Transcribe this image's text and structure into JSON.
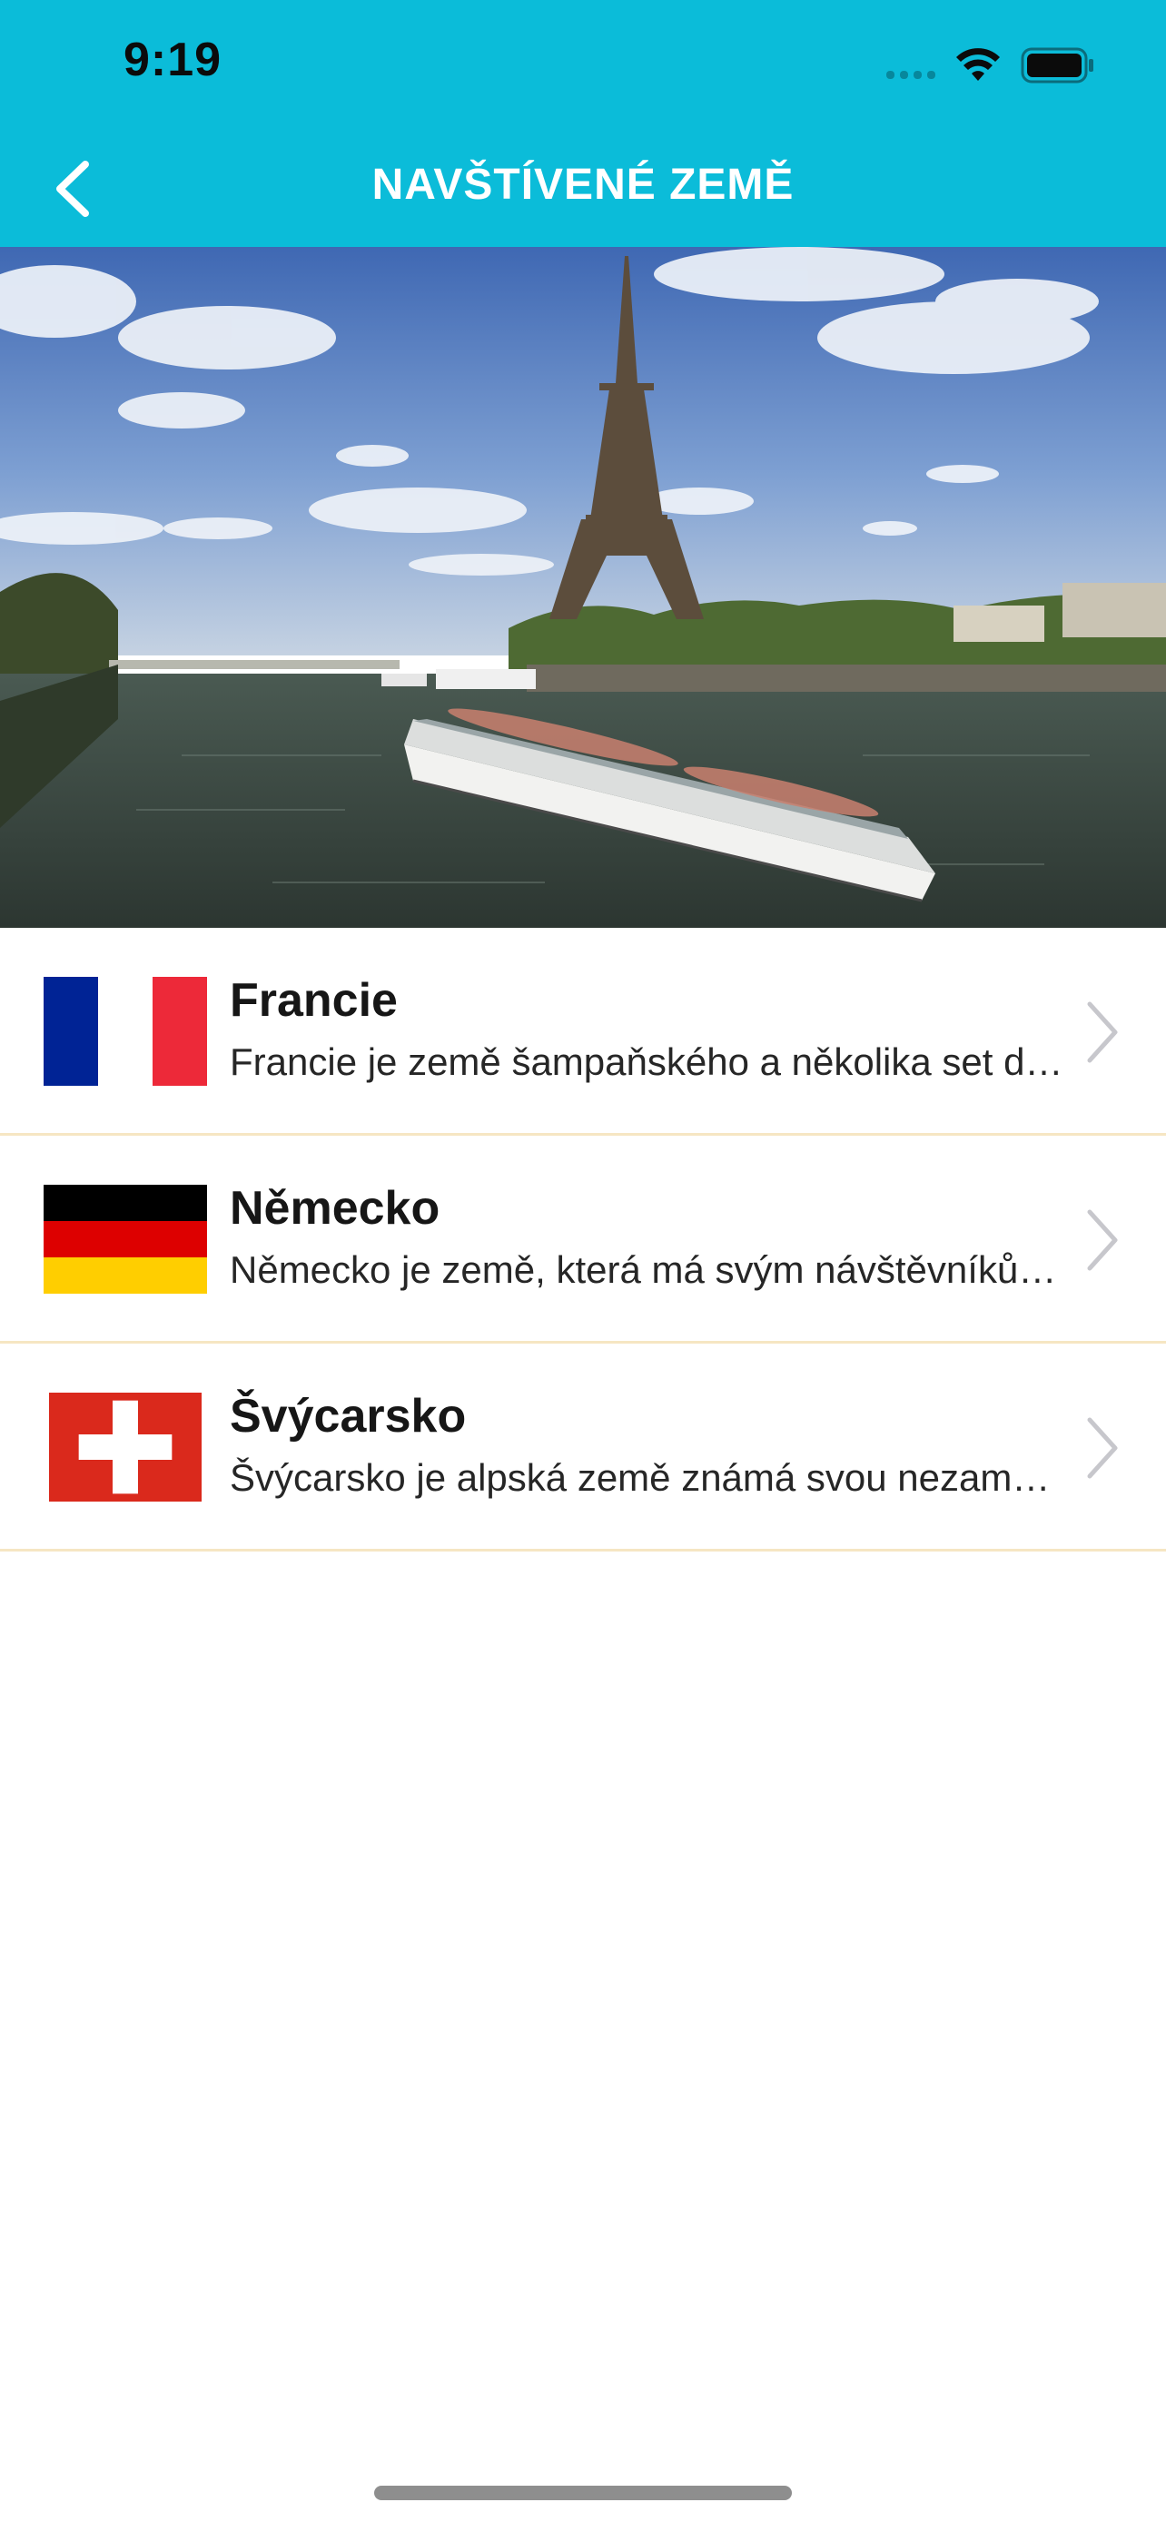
{
  "status_bar": {
    "time": "9:19"
  },
  "nav": {
    "title": "NAVŠTÍVENÉ ZEMĚ",
    "back_icon": "chevron-left-icon"
  },
  "hero": {
    "image": "eiffel-tower-river-cruise-photo"
  },
  "countries": [
    {
      "name": "Francie",
      "description": "Francie je země šampaňského a několika set druhů sýrů",
      "flag": "france-flag"
    },
    {
      "name": "Německo",
      "description": "Německo je země, která má svým návštěvníkům co nabídnout",
      "flag": "germany-flag"
    },
    {
      "name": "Švýcarsko",
      "description": "Švýcarsko je alpská země známá svou nezaměnitelnou přírodou",
      "flag": "switzerland-flag"
    }
  ],
  "colors": {
    "header": "#0bbcd9",
    "separator": "#f6e6c3",
    "france_blue": "#002395",
    "france_red": "#ed2939",
    "germany_black": "#000000",
    "germany_red": "#dd0000",
    "germany_gold": "#ffce00",
    "swiss_red": "#da291c"
  }
}
